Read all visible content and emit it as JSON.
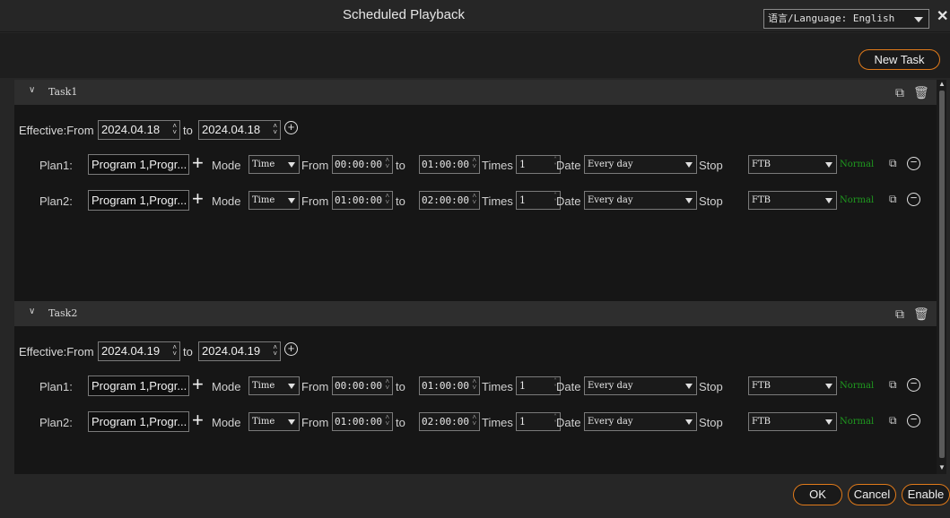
{
  "window": {
    "title": "Scheduled Playback",
    "language_label": "语言/Language: English",
    "close_glyph": "✕"
  },
  "toolbar": {
    "new_task_label": "New Task"
  },
  "footer": {
    "ok_label": "OK",
    "cancel_label": "Cancel",
    "enable_label": "Enable"
  },
  "labels": {
    "effective_from": "Effective:From",
    "to": "to",
    "mode": "Mode",
    "from": "From",
    "times": "Times",
    "date": "Date",
    "stop": "Stop"
  },
  "tasks": [
    {
      "name": "Task1",
      "from_date": "2024.04.18",
      "to_date": "2024.04.18",
      "plans": [
        {
          "label": "Plan1:",
          "program": "Program 1,Progr...",
          "mode": "Time",
          "from": "00:00:00",
          "to": "01:00:00",
          "times": "1",
          "date": "Every day",
          "stop": "FTB",
          "status": "Normal"
        },
        {
          "label": "Plan2:",
          "program": "Program 1,Progr...",
          "mode": "Time",
          "from": "01:00:00",
          "to": "02:00:00",
          "times": "1",
          "date": "Every day",
          "stop": "FTB",
          "status": "Normal"
        }
      ]
    },
    {
      "name": "Task2",
      "from_date": "2024.04.19",
      "to_date": "2024.04.19",
      "plans": [
        {
          "label": "Plan1:",
          "program": "Program 1,Progr...",
          "mode": "Time",
          "from": "00:00:00",
          "to": "01:00:00",
          "times": "1",
          "date": "Every day",
          "stop": "FTB",
          "status": "Normal"
        },
        {
          "label": "Plan2:",
          "program": "Program 1,Progr...",
          "mode": "Time",
          "from": "01:00:00",
          "to": "02:00:00",
          "times": "1",
          "date": "Every day",
          "stop": "FTB",
          "status": "Normal"
        }
      ]
    }
  ],
  "colors": {
    "accent": "#e07a1a",
    "status_normal": "#1f9a1f"
  }
}
